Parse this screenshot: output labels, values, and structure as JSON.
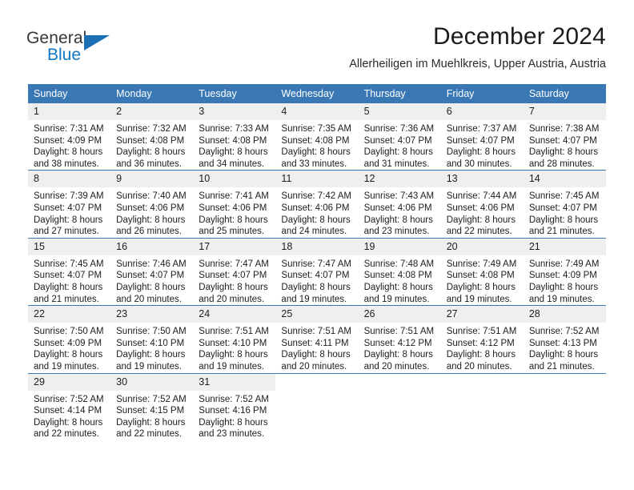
{
  "brand": {
    "name_part1": "General",
    "name_part2": "Blue",
    "triangle_icon": "triangle-icon",
    "color_dark": "#363636",
    "color_blue": "#1277c4"
  },
  "header": {
    "title": "December 2024",
    "subtitle": "Allerheiligen im Muehlkreis, Upper Austria, Austria"
  },
  "calendar": {
    "accent_color": "#3a78b5",
    "daynum_band_color": "#efefef",
    "weekday_headers": [
      "Sunday",
      "Monday",
      "Tuesday",
      "Wednesday",
      "Thursday",
      "Friday",
      "Saturday"
    ],
    "weeks": [
      [
        {
          "day": "1",
          "sunrise": "Sunrise: 7:31 AM",
          "sunset": "Sunset: 4:09 PM",
          "daylight_line1": "Daylight: 8 hours",
          "daylight_line2": "and 38 minutes."
        },
        {
          "day": "2",
          "sunrise": "Sunrise: 7:32 AM",
          "sunset": "Sunset: 4:08 PM",
          "daylight_line1": "Daylight: 8 hours",
          "daylight_line2": "and 36 minutes."
        },
        {
          "day": "3",
          "sunrise": "Sunrise: 7:33 AM",
          "sunset": "Sunset: 4:08 PM",
          "daylight_line1": "Daylight: 8 hours",
          "daylight_line2": "and 34 minutes."
        },
        {
          "day": "4",
          "sunrise": "Sunrise: 7:35 AM",
          "sunset": "Sunset: 4:08 PM",
          "daylight_line1": "Daylight: 8 hours",
          "daylight_line2": "and 33 minutes."
        },
        {
          "day": "5",
          "sunrise": "Sunrise: 7:36 AM",
          "sunset": "Sunset: 4:07 PM",
          "daylight_line1": "Daylight: 8 hours",
          "daylight_line2": "and 31 minutes."
        },
        {
          "day": "6",
          "sunrise": "Sunrise: 7:37 AM",
          "sunset": "Sunset: 4:07 PM",
          "daylight_line1": "Daylight: 8 hours",
          "daylight_line2": "and 30 minutes."
        },
        {
          "day": "7",
          "sunrise": "Sunrise: 7:38 AM",
          "sunset": "Sunset: 4:07 PM",
          "daylight_line1": "Daylight: 8 hours",
          "daylight_line2": "and 28 minutes."
        }
      ],
      [
        {
          "day": "8",
          "sunrise": "Sunrise: 7:39 AM",
          "sunset": "Sunset: 4:07 PM",
          "daylight_line1": "Daylight: 8 hours",
          "daylight_line2": "and 27 minutes."
        },
        {
          "day": "9",
          "sunrise": "Sunrise: 7:40 AM",
          "sunset": "Sunset: 4:06 PM",
          "daylight_line1": "Daylight: 8 hours",
          "daylight_line2": "and 26 minutes."
        },
        {
          "day": "10",
          "sunrise": "Sunrise: 7:41 AM",
          "sunset": "Sunset: 4:06 PM",
          "daylight_line1": "Daylight: 8 hours",
          "daylight_line2": "and 25 minutes."
        },
        {
          "day": "11",
          "sunrise": "Sunrise: 7:42 AM",
          "sunset": "Sunset: 4:06 PM",
          "daylight_line1": "Daylight: 8 hours",
          "daylight_line2": "and 24 minutes."
        },
        {
          "day": "12",
          "sunrise": "Sunrise: 7:43 AM",
          "sunset": "Sunset: 4:06 PM",
          "daylight_line1": "Daylight: 8 hours",
          "daylight_line2": "and 23 minutes."
        },
        {
          "day": "13",
          "sunrise": "Sunrise: 7:44 AM",
          "sunset": "Sunset: 4:06 PM",
          "daylight_line1": "Daylight: 8 hours",
          "daylight_line2": "and 22 minutes."
        },
        {
          "day": "14",
          "sunrise": "Sunrise: 7:45 AM",
          "sunset": "Sunset: 4:07 PM",
          "daylight_line1": "Daylight: 8 hours",
          "daylight_line2": "and 21 minutes."
        }
      ],
      [
        {
          "day": "15",
          "sunrise": "Sunrise: 7:45 AM",
          "sunset": "Sunset: 4:07 PM",
          "daylight_line1": "Daylight: 8 hours",
          "daylight_line2": "and 21 minutes."
        },
        {
          "day": "16",
          "sunrise": "Sunrise: 7:46 AM",
          "sunset": "Sunset: 4:07 PM",
          "daylight_line1": "Daylight: 8 hours",
          "daylight_line2": "and 20 minutes."
        },
        {
          "day": "17",
          "sunrise": "Sunrise: 7:47 AM",
          "sunset": "Sunset: 4:07 PM",
          "daylight_line1": "Daylight: 8 hours",
          "daylight_line2": "and 20 minutes."
        },
        {
          "day": "18",
          "sunrise": "Sunrise: 7:47 AM",
          "sunset": "Sunset: 4:07 PM",
          "daylight_line1": "Daylight: 8 hours",
          "daylight_line2": "and 19 minutes."
        },
        {
          "day": "19",
          "sunrise": "Sunrise: 7:48 AM",
          "sunset": "Sunset: 4:08 PM",
          "daylight_line1": "Daylight: 8 hours",
          "daylight_line2": "and 19 minutes."
        },
        {
          "day": "20",
          "sunrise": "Sunrise: 7:49 AM",
          "sunset": "Sunset: 4:08 PM",
          "daylight_line1": "Daylight: 8 hours",
          "daylight_line2": "and 19 minutes."
        },
        {
          "day": "21",
          "sunrise": "Sunrise: 7:49 AM",
          "sunset": "Sunset: 4:09 PM",
          "daylight_line1": "Daylight: 8 hours",
          "daylight_line2": "and 19 minutes."
        }
      ],
      [
        {
          "day": "22",
          "sunrise": "Sunrise: 7:50 AM",
          "sunset": "Sunset: 4:09 PM",
          "daylight_line1": "Daylight: 8 hours",
          "daylight_line2": "and 19 minutes."
        },
        {
          "day": "23",
          "sunrise": "Sunrise: 7:50 AM",
          "sunset": "Sunset: 4:10 PM",
          "daylight_line1": "Daylight: 8 hours",
          "daylight_line2": "and 19 minutes."
        },
        {
          "day": "24",
          "sunrise": "Sunrise: 7:51 AM",
          "sunset": "Sunset: 4:10 PM",
          "daylight_line1": "Daylight: 8 hours",
          "daylight_line2": "and 19 minutes."
        },
        {
          "day": "25",
          "sunrise": "Sunrise: 7:51 AM",
          "sunset": "Sunset: 4:11 PM",
          "daylight_line1": "Daylight: 8 hours",
          "daylight_line2": "and 20 minutes."
        },
        {
          "day": "26",
          "sunrise": "Sunrise: 7:51 AM",
          "sunset": "Sunset: 4:12 PM",
          "daylight_line1": "Daylight: 8 hours",
          "daylight_line2": "and 20 minutes."
        },
        {
          "day": "27",
          "sunrise": "Sunrise: 7:51 AM",
          "sunset": "Sunset: 4:12 PM",
          "daylight_line1": "Daylight: 8 hours",
          "daylight_line2": "and 20 minutes."
        },
        {
          "day": "28",
          "sunrise": "Sunrise: 7:52 AM",
          "sunset": "Sunset: 4:13 PM",
          "daylight_line1": "Daylight: 8 hours",
          "daylight_line2": "and 21 minutes."
        }
      ],
      [
        {
          "day": "29",
          "sunrise": "Sunrise: 7:52 AM",
          "sunset": "Sunset: 4:14 PM",
          "daylight_line1": "Daylight: 8 hours",
          "daylight_line2": "and 22 minutes."
        },
        {
          "day": "30",
          "sunrise": "Sunrise: 7:52 AM",
          "sunset": "Sunset: 4:15 PM",
          "daylight_line1": "Daylight: 8 hours",
          "daylight_line2": "and 22 minutes."
        },
        {
          "day": "31",
          "sunrise": "Sunrise: 7:52 AM",
          "sunset": "Sunset: 4:16 PM",
          "daylight_line1": "Daylight: 8 hours",
          "daylight_line2": "and 23 minutes."
        },
        {
          "day": "",
          "sunrise": "",
          "sunset": "",
          "daylight_line1": "",
          "daylight_line2": ""
        },
        {
          "day": "",
          "sunrise": "",
          "sunset": "",
          "daylight_line1": "",
          "daylight_line2": ""
        },
        {
          "day": "",
          "sunrise": "",
          "sunset": "",
          "daylight_line1": "",
          "daylight_line2": ""
        },
        {
          "day": "",
          "sunrise": "",
          "sunset": "",
          "daylight_line1": "",
          "daylight_line2": ""
        }
      ]
    ]
  }
}
